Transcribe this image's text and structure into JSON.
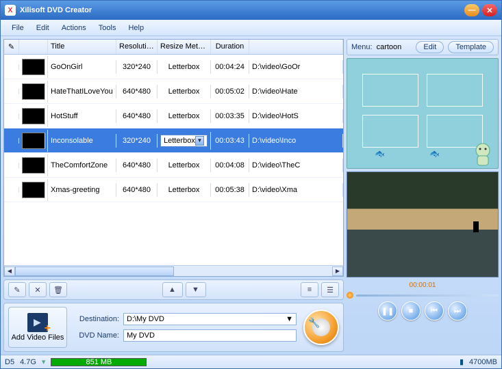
{
  "app_title": "Xilisoft DVD Creator",
  "menus": [
    "File",
    "Edit",
    "Actions",
    "Tools",
    "Help"
  ],
  "table": {
    "headers": {
      "title": "Title",
      "resolution": "Resolution",
      "resize": "Resize Method",
      "duration": "Duration"
    },
    "rows": [
      {
        "title": "GoOnGirl",
        "res": "320*240",
        "resize": "Letterbox",
        "dur": "00:04:24",
        "path": "D:\\video\\GoOr",
        "selected": false
      },
      {
        "title": "HateThatILoveYou",
        "res": "640*480",
        "resize": "Letterbox",
        "dur": "00:05:02",
        "path": "D:\\video\\Hate",
        "selected": false
      },
      {
        "title": "HotStuff",
        "res": "640*480",
        "resize": "Letterbox",
        "dur": "00:03:35",
        "path": "D:\\video\\HotS",
        "selected": false
      },
      {
        "title": "Inconsolable",
        "res": "320*240",
        "resize": "Letterbox",
        "dur": "00:03:43",
        "path": "D:\\video\\Inco",
        "selected": true
      },
      {
        "title": "TheComfortZone",
        "res": "640*480",
        "resize": "Letterbox",
        "dur": "00:04:08",
        "path": "D:\\video\\TheC",
        "selected": false
      },
      {
        "title": "Xmas-greeting",
        "res": "640*480",
        "resize": "Letterbox",
        "dur": "00:05:38",
        "path": "D:\\video\\Xma",
        "selected": false
      }
    ]
  },
  "dest": {
    "label": "Destination:",
    "value": "D:\\My DVD"
  },
  "dvdname": {
    "label": "DVD Name:",
    "value": "My DVD"
  },
  "addvideo_label": "Add Video Files",
  "status": {
    "disc": "D5",
    "capacity": "4.7G",
    "used": "851 MB",
    "total": "4700MB"
  },
  "menu_panel": {
    "label": "Menu:",
    "name": "cartoon",
    "edit": "Edit",
    "template": "Template"
  },
  "timecode": "00:00:01"
}
